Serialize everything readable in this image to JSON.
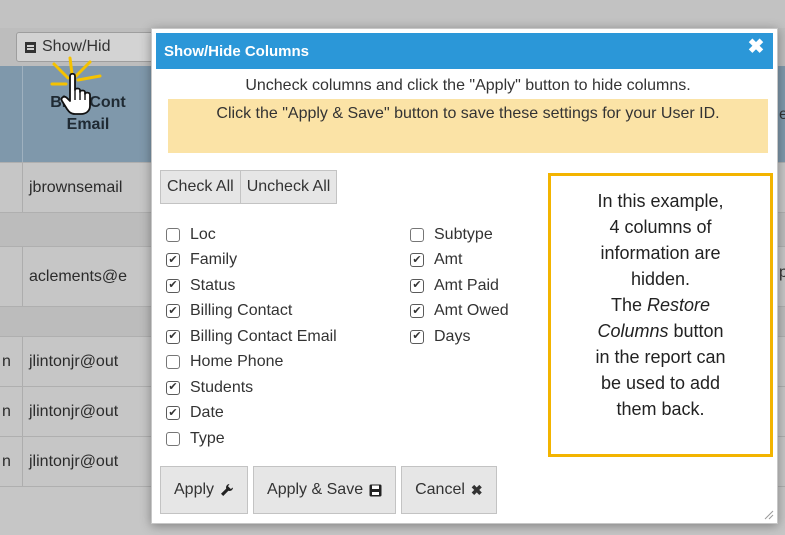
{
  "background": {
    "toolbar_button_label": "Show/Hid",
    "header_cell": "Billing Contact Email",
    "header_cell_lines": [
      "Bi  g Cont",
      "Email"
    ],
    "rows": [
      {
        "prefix": "",
        "text": "jbrownsemail"
      },
      {
        "prefix": "",
        "text": "aclements@e"
      },
      {
        "prefix": "n",
        "text": "jlintonjr@out"
      },
      {
        "prefix": "n",
        "text": "jlintonjr@out"
      },
      {
        "prefix": "n",
        "text": "jlintonjr@out"
      }
    ],
    "right_char_1": "e",
    "right_char_2": "p"
  },
  "dialog": {
    "title": "Show/Hide Columns",
    "close_icon": "close-icon",
    "instruction": "Uncheck columns and click the \"Apply\" button to hide columns.",
    "save_note": "Click the \"Apply & Save\" button to save these settings for your User ID.",
    "check_all_label": "Check All",
    "uncheck_all_label": "Uncheck All",
    "columns_left": [
      {
        "label": "Loc",
        "checked": false
      },
      {
        "label": "Family",
        "checked": true
      },
      {
        "label": "Status",
        "checked": true
      },
      {
        "label": "Billing Contact",
        "checked": true
      },
      {
        "label": "Billing Contact Email",
        "checked": true
      },
      {
        "label": "Home Phone",
        "checked": false
      },
      {
        "label": "Students",
        "checked": true
      },
      {
        "label": "Date",
        "checked": true
      },
      {
        "label": "Type",
        "checked": false
      }
    ],
    "columns_right": [
      {
        "label": "Subtype",
        "checked": false
      },
      {
        "label": "Amt",
        "checked": true
      },
      {
        "label": "Amt Paid",
        "checked": true
      },
      {
        "label": "Amt Owed",
        "checked": true
      },
      {
        "label": "Days",
        "checked": true
      }
    ],
    "callout": {
      "line1": "In this example,",
      "line2": "4 columns of",
      "line3": "information are",
      "line4": "hidden.",
      "line5_prefix": "The ",
      "line5_em": "Restore",
      "line6_em": "Columns",
      "line6_suffix": " button",
      "line7": "in the report can",
      "line8": "be used to add",
      "line9": "them back."
    },
    "apply_label": "Apply",
    "apply_icon": "wrench-icon",
    "apply_save_label": "Apply & Save",
    "apply_save_icon": "floppy-disk-icon",
    "cancel_label": "Cancel",
    "cancel_icon": "x-icon"
  },
  "colors": {
    "titlebar": "#2b97d8",
    "note_bg": "#fbe3a6",
    "callout_border": "#f3b400"
  }
}
